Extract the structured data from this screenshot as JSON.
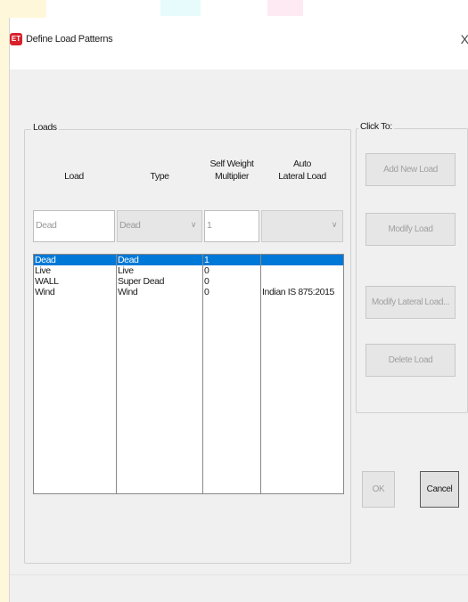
{
  "window": {
    "title": "Define Load Patterns",
    "icon_text": "ET",
    "close_glyph": "X"
  },
  "loads_group": {
    "label": "Loads",
    "columns": [
      {
        "line1": "",
        "line2": "Load"
      },
      {
        "line1": "",
        "line2": "Type"
      },
      {
        "line1": "Self Weight",
        "line2": "Multiplier"
      },
      {
        "line1": "Auto",
        "line2": "Lateral Load"
      }
    ],
    "edit_row": {
      "load": "Dead",
      "type": "Dead",
      "multiplier": "1",
      "auto_lateral": ""
    },
    "rows": [
      {
        "load": "Dead",
        "type": "Dead",
        "multiplier": "1",
        "auto_lateral": "",
        "selected": true
      },
      {
        "load": "Live",
        "type": "Live",
        "multiplier": "0",
        "auto_lateral": "",
        "selected": false
      },
      {
        "load": "WALL",
        "type": "Super Dead",
        "multiplier": "0",
        "auto_lateral": "",
        "selected": false
      },
      {
        "load": "Wind",
        "type": "Wind",
        "multiplier": "0",
        "auto_lateral": "Indian IS 875:2015",
        "selected": false
      }
    ]
  },
  "click_to_group": {
    "label": "Click To:",
    "buttons": {
      "add": "Add New Load",
      "modify": "Modify Load",
      "modify_lateral": "Modify Lateral Load...",
      "delete": "Delete Load"
    }
  },
  "footer": {
    "ok": "OK",
    "cancel": "Cancel"
  }
}
